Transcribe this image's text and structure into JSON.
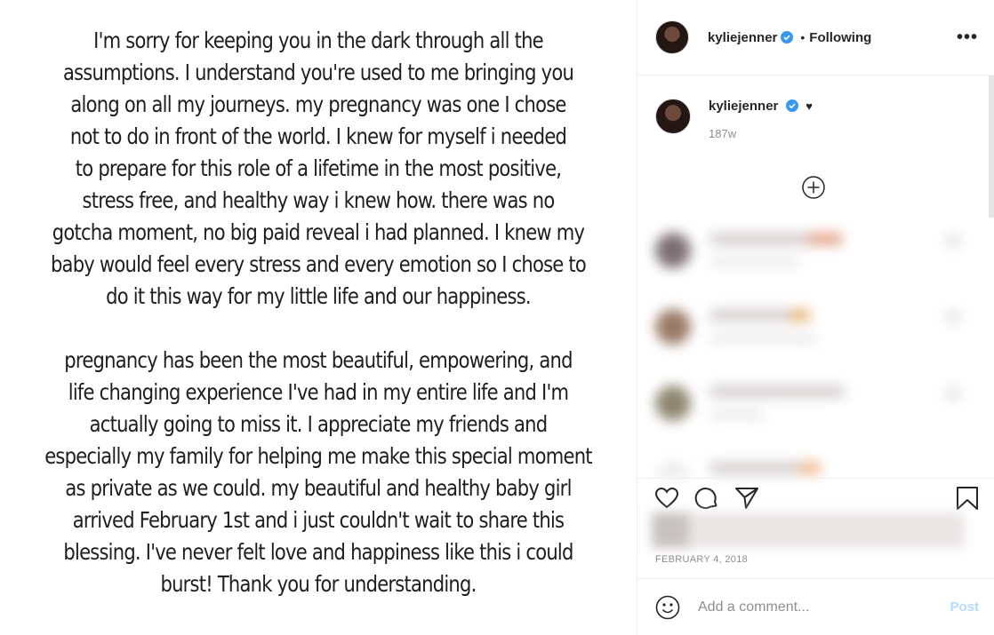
{
  "post_image": {
    "paragraphs": [
      [
        "I'm sorry for keeping you in the dark through all the",
        "assumptions. I understand you're used to me bringing you",
        "along on all my journeys. my pregnancy was one I chose",
        "not to do in front of the world. I knew for myself i needed",
        "to prepare for this role of a lifetime in the most positive,",
        "stress free, and healthy way i knew how. there was no",
        "gotcha moment, no big paid reveal i had planned. I knew my",
        "baby would feel every stress and every emotion so I chose to",
        "do it this way for my little life and our happiness."
      ],
      [
        "pregnancy has been the most beautiful, empowering, and",
        "life changing experience I've had in my entire life and I'm",
        "actually going to miss it. I appreciate my friends and",
        "especially my family for helping me make this special moment",
        "as private as we could. my beautiful and healthy baby girl",
        "arrived February 1st and i just couldn't wait to share this",
        "blessing. I've never felt love and happiness like this i could",
        "burst! Thank you for understanding."
      ]
    ]
  },
  "header": {
    "username": "kyliejenner",
    "separator": "•",
    "follow_status": "Following",
    "more_label": "•••"
  },
  "caption": {
    "username": "kyliejenner",
    "text": "♥",
    "time": "187w"
  },
  "post_meta": {
    "date": "FEBRUARY 4, 2018"
  },
  "comment_box": {
    "placeholder": "Add a comment...",
    "post_label": "Post"
  },
  "colors": {
    "verified": "#3897f0",
    "post_button": "#b3dbff",
    "muted_text": "#8e8e8e"
  }
}
